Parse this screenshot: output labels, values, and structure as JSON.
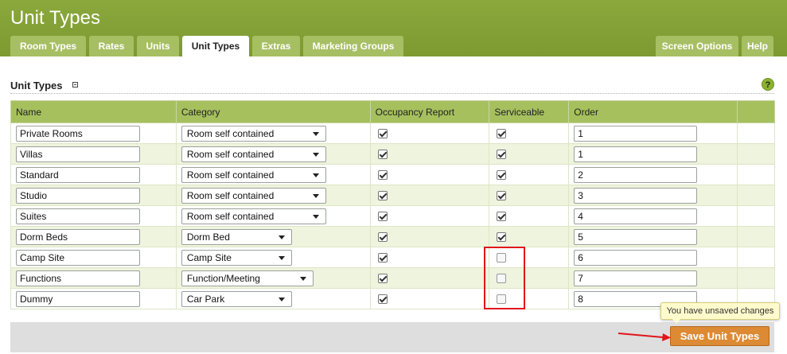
{
  "header": {
    "title": "Unit Types",
    "tabs": [
      "Room Types",
      "Rates",
      "Units",
      "Unit Types",
      "Extras",
      "Marketing Groups"
    ],
    "active_tab": "Unit Types",
    "right_tabs": [
      "Screen Options",
      "Help"
    ]
  },
  "section": {
    "title": "Unit Types",
    "help_glyph": "?"
  },
  "table": {
    "columns": [
      "Name",
      "Category",
      "Occupancy Report",
      "Serviceable",
      "Order",
      ""
    ],
    "rows": [
      {
        "name": "Private Rooms",
        "category": "Room self contained",
        "occupancy": true,
        "serviceable": true,
        "order": "1"
      },
      {
        "name": "Villas",
        "category": "Room self contained",
        "occupancy": true,
        "serviceable": true,
        "order": "1"
      },
      {
        "name": "Standard",
        "category": "Room self contained",
        "occupancy": true,
        "serviceable": true,
        "order": "2"
      },
      {
        "name": "Studio",
        "category": "Room self contained",
        "occupancy": true,
        "serviceable": true,
        "order": "3"
      },
      {
        "name": "Suites",
        "category": "Room self contained",
        "occupancy": true,
        "serviceable": true,
        "order": "4"
      },
      {
        "name": "Dorm Beds",
        "category": "Dorm Bed",
        "occupancy": true,
        "serviceable": true,
        "order": "5"
      },
      {
        "name": "Camp Site",
        "category": "Camp Site",
        "occupancy": true,
        "serviceable": false,
        "order": "6"
      },
      {
        "name": "Functions",
        "category": "Function/Meeting",
        "occupancy": true,
        "serviceable": false,
        "order": "7"
      },
      {
        "name": "Dummy",
        "category": "Car Park",
        "occupancy": true,
        "serviceable": false,
        "order": "8"
      }
    ]
  },
  "footer": {
    "tooltip": "You have unsaved changes",
    "save_label": "Save Unit Types"
  },
  "colors": {
    "header_green": "#7d9a31",
    "tab_green": "#a7bf63",
    "save_orange": "#dc8a34",
    "annotation_red": "#e0161b"
  }
}
